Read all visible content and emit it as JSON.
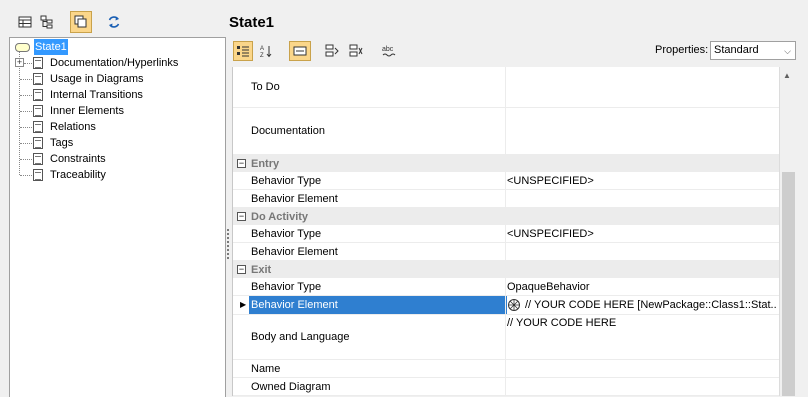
{
  "top_toolbar": {
    "buttons": [
      "table-view-icon",
      "tree-view-icon",
      "copy-icon",
      "refresh-icon"
    ]
  },
  "page_title": "State1",
  "tree": {
    "root": "State1",
    "items": [
      "Documentation/Hyperlinks",
      "Usage in Diagrams",
      "Internal Transitions",
      "Inner Elements",
      "Relations",
      "Tags",
      "Constraints",
      "Traceability"
    ]
  },
  "properties_toolbar": {
    "label": "Properties:",
    "selected": "Standard"
  },
  "grid": {
    "rows": [
      {
        "name": "To Do",
        "value": ""
      },
      {
        "name": "Documentation",
        "value": ""
      },
      {
        "group": "Entry"
      },
      {
        "name": "Behavior Type",
        "value": "<UNSPECIFIED>"
      },
      {
        "name": "Behavior Element",
        "value": ""
      },
      {
        "group": "Do Activity"
      },
      {
        "name": "Behavior Type",
        "value": "<UNSPECIFIED>"
      },
      {
        "name": "Behavior Element",
        "value": ""
      },
      {
        "group": "Exit"
      },
      {
        "name": "Behavior Type",
        "value": "OpaqueBehavior"
      },
      {
        "name": "Behavior Element",
        "value": "// YOUR CODE HERE [NewPackage::Class1::Stat..."
      },
      {
        "name": "Body and Language",
        "value": "// YOUR CODE HERE"
      },
      {
        "name": "Name",
        "value": ""
      },
      {
        "name": "Owned Diagram",
        "value": ""
      }
    ]
  }
}
